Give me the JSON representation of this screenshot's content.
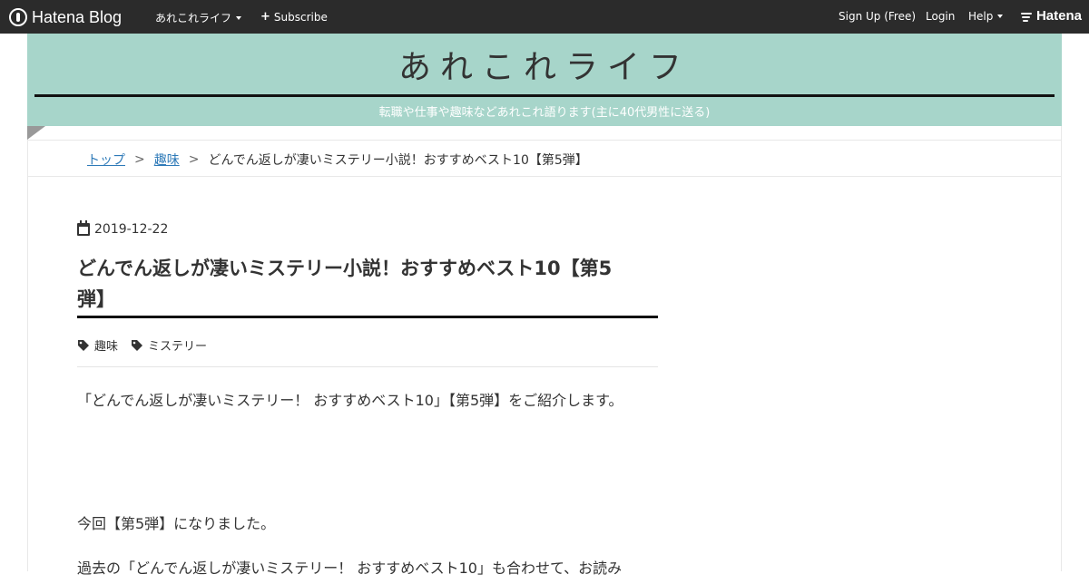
{
  "topbar": {
    "brand": "Hatena Blog",
    "blog_menu": "あれこれライフ",
    "subscribe": "Subscribe",
    "signup": "Sign Up (Free)",
    "login": "Login",
    "help": "Help",
    "hatena": "Hatena"
  },
  "header": {
    "title": "あれこれライフ",
    "description": "転職や仕事や趣味などあれこれ語ります(主に40代男性に送る)",
    "accent_color": "#a7d5ca"
  },
  "breadcrumb": {
    "items": [
      "トップ",
      "趣味"
    ],
    "separator": ">",
    "current": "どんでん返しが凄いミステリー小説！おすすめベスト10【第5弾】"
  },
  "entry": {
    "date": "2019-12-22",
    "title": "どんでん返しが凄いミステリー小説！おすすめベスト10【第5弾】",
    "tags": [
      "趣味",
      "ミステリー"
    ],
    "paragraphs": [
      "「どんでん返しが凄いミステリー！ おすすめベスト10」【第5弾】をご紹介します。",
      "今回【第5弾】になりました。",
      "過去の「どんでん返しが凄いミステリー！ おすすめベスト10」も合わせて、お読み"
    ]
  }
}
